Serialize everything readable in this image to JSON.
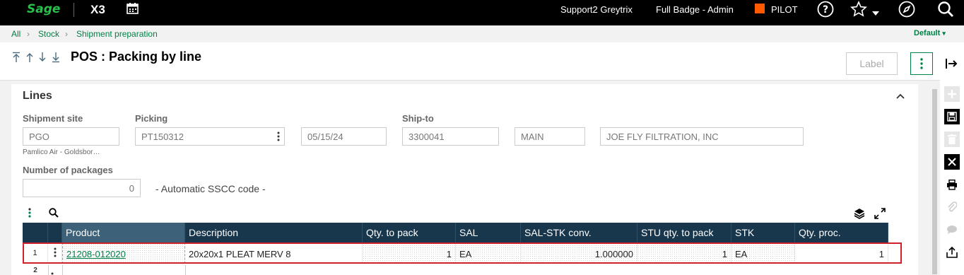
{
  "topbar": {
    "logo": "Sage",
    "app": "X3",
    "user": "Support2 Greytrix",
    "role": "Full Badge - Admin",
    "environment": "PILOT",
    "env_color": "#ff5a00",
    "icons": [
      "calendar-icon",
      "help-icon",
      "star-icon",
      "compass-icon",
      "search-icon"
    ]
  },
  "breadcrumb": {
    "items": [
      "All",
      "Stock",
      "Shipment preparation"
    ],
    "view": "Default"
  },
  "header": {
    "title": "POS : Packing by line",
    "label_button": "Label"
  },
  "section": {
    "title": "Lines",
    "shipment_site_label": "Shipment site",
    "shipment_site_value": "PGO",
    "shipment_site_desc": "Pamlico Air - Goldsbor…",
    "picking_label": "Picking",
    "picking_value": "PT150312",
    "date_value": "05/15/24",
    "ship_to_label": "Ship-to",
    "ship_to_value": "3300041",
    "address_code": "MAIN",
    "customer_name": "JOE FLY FILTRATION, INC",
    "packages_label": "Number of packages",
    "packages_value": "0",
    "sscc_text": "- Automatic SSCC code -"
  },
  "grid": {
    "headers": [
      "Product",
      "Description",
      "Qty. to pack",
      "SAL",
      "SAL-STK conv.",
      "STU qty. to pack",
      "STK",
      "Qty. proc."
    ],
    "rows": [
      {
        "num": "1",
        "product": "21208-012020",
        "description": "20x20x1 PLEAT MERV 8",
        "qty_to_pack": "1",
        "sal": "EA",
        "conv": "1.000000",
        "stu_qty": "1",
        "stk": "EA",
        "qty_proc": "1"
      },
      {
        "num": "2"
      }
    ]
  },
  "colors": {
    "accent": "#008146",
    "header_bg": "#18374d",
    "highlight": "#d0202a"
  }
}
